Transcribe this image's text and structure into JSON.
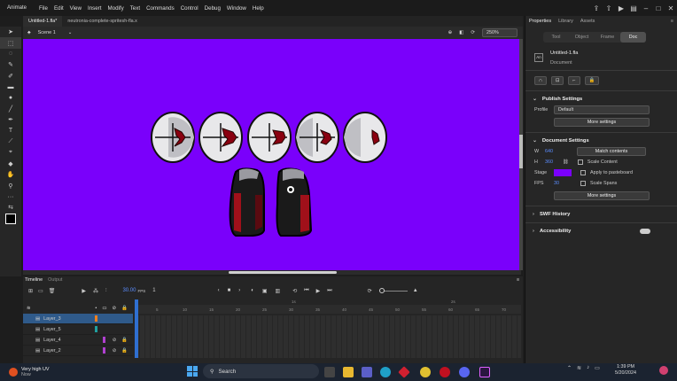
{
  "app": {
    "name": "Animate"
  },
  "menu": [
    "File",
    "Edit",
    "View",
    "Insert",
    "Modify",
    "Text",
    "Commands",
    "Control",
    "Debug",
    "Window",
    "Help"
  ],
  "doc_tabs": [
    "Untitled-1.fla*",
    "neutronia-complete-spritesh-fla.x"
  ],
  "edit_bar": {
    "scene": "Scene 1",
    "zoom": "250%"
  },
  "props": {
    "header_tabs": [
      "Properties",
      "Library",
      "Assets"
    ],
    "seg": [
      "Tool",
      "Object",
      "Frame",
      "Doc"
    ],
    "doc_name": "Untitled-1.fla",
    "doc_type": "Document",
    "publish": {
      "title": "Publish Settings",
      "profile_label": "Profile",
      "profile_value": "Default",
      "more": "More settings"
    },
    "docset": {
      "title": "Document Settings",
      "w_label": "W",
      "w": "640",
      "h_label": "H",
      "h": "360",
      "match": "Match contents",
      "scale_content": "Scale Content",
      "stage_label": "Stage",
      "apply_pb": "Apply to pasteboard",
      "fps_label": "FPS",
      "fps": "30",
      "scale_spans": "Scale Spans",
      "more": "More settings"
    },
    "swf": "SWF History",
    "access": "Accessibility",
    "stage_color": "#7a00fb"
  },
  "timeline": {
    "tabs": [
      "Timeline",
      "Output"
    ],
    "fps": "30.00",
    "fps_unit": "FPS",
    "frame": "1",
    "ticks": [
      "5",
      "10",
      "15",
      "20",
      "25",
      "30",
      "35",
      "40",
      "45",
      "50",
      "55",
      "60",
      "65",
      "70"
    ],
    "marks": [
      "1s",
      "2s"
    ],
    "layers": [
      "Layer_3",
      "Layer_5",
      "Layer_4",
      "Layer_2"
    ]
  },
  "taskbar": {
    "weather_temp": "Very high UV",
    "weather_sub": "Now",
    "search": "Search",
    "time": "1:39 PM",
    "date": "5/20/2024"
  },
  "icons": [
    "search-icon",
    "windows-start-icon",
    "gear-icon",
    "lock-icon",
    "eye-icon"
  ]
}
